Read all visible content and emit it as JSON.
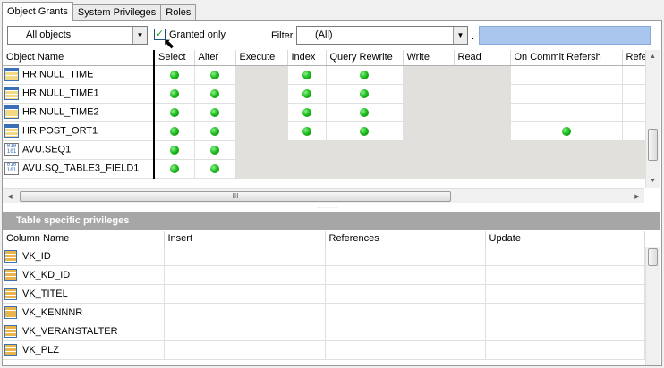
{
  "tabs": [
    {
      "label": "Object Grants",
      "active": true
    },
    {
      "label": "System Privileges",
      "active": false
    },
    {
      "label": "Roles",
      "active": false
    }
  ],
  "toolbar": {
    "object_type": "All objects",
    "granted_only_label": "Granted only",
    "granted_only_checked": true,
    "filter_label": "Filter",
    "filter_value": "(All)",
    "dot": "."
  },
  "grants": {
    "columns": [
      "Object Name",
      "Select",
      "Alter",
      "Execute",
      "Index",
      "Query Rewrite",
      "Write",
      "Read",
      "On Commit Refersh",
      "Refer"
    ],
    "rows": [
      {
        "name": "HR.NULL_TIME",
        "icon": "table-icon",
        "cells": [
          "dot",
          "dot",
          "gray",
          "dot",
          "dot",
          "gray",
          "gray",
          "",
          ""
        ]
      },
      {
        "name": "HR.NULL_TIME1",
        "icon": "table-icon",
        "cells": [
          "dot",
          "dot",
          "gray",
          "dot",
          "dot",
          "gray",
          "gray",
          "",
          ""
        ]
      },
      {
        "name": "HR.NULL_TIME2",
        "icon": "table-icon",
        "cells": [
          "dot",
          "dot",
          "gray",
          "dot",
          "dot",
          "gray",
          "gray",
          "",
          ""
        ]
      },
      {
        "name": "HR.POST_ORT1",
        "icon": "table-icon",
        "cells": [
          "dot",
          "dot",
          "gray",
          "dot",
          "dot",
          "gray",
          "gray",
          "dot",
          ""
        ]
      },
      {
        "name": "AVU.SEQ1",
        "icon": "sequence-icon",
        "cells": [
          "dot",
          "dot",
          "gray",
          "gray",
          "gray",
          "gray",
          "gray",
          "gray",
          "gray"
        ]
      },
      {
        "name": "AVU.SQ_TABLE3_FIELD1",
        "icon": "sequence-icon",
        "cells": [
          "dot",
          "dot",
          "gray",
          "gray",
          "gray",
          "gray",
          "gray",
          "gray",
          "gray"
        ]
      }
    ]
  },
  "splitter_grip": "········",
  "scroll_grip": "III",
  "table_privileges": {
    "title": "Table specific privileges",
    "columns": [
      "Column Name",
      "Insert",
      "References",
      "Update"
    ],
    "rows": [
      "VK_ID",
      "VK_KD_ID",
      "VK_TITEL",
      "VK_KENNNR",
      "VK_VERANSTALTER",
      "VK_PLZ"
    ]
  },
  "icons": {
    "granted": "green-dot-icon",
    "dropdown": "chevron-down-icon",
    "scroll_up": "arrow-up-icon",
    "scroll_down": "arrow-down-icon",
    "scroll_left": "arrow-left-icon",
    "scroll_right": "arrow-right-icon"
  },
  "colors": {
    "granted_dot": "#1fbf1f",
    "disabled_cell": "#e1e0dc",
    "filter_box": "#a9c6ef",
    "panel_header": "#a6a6a6"
  }
}
